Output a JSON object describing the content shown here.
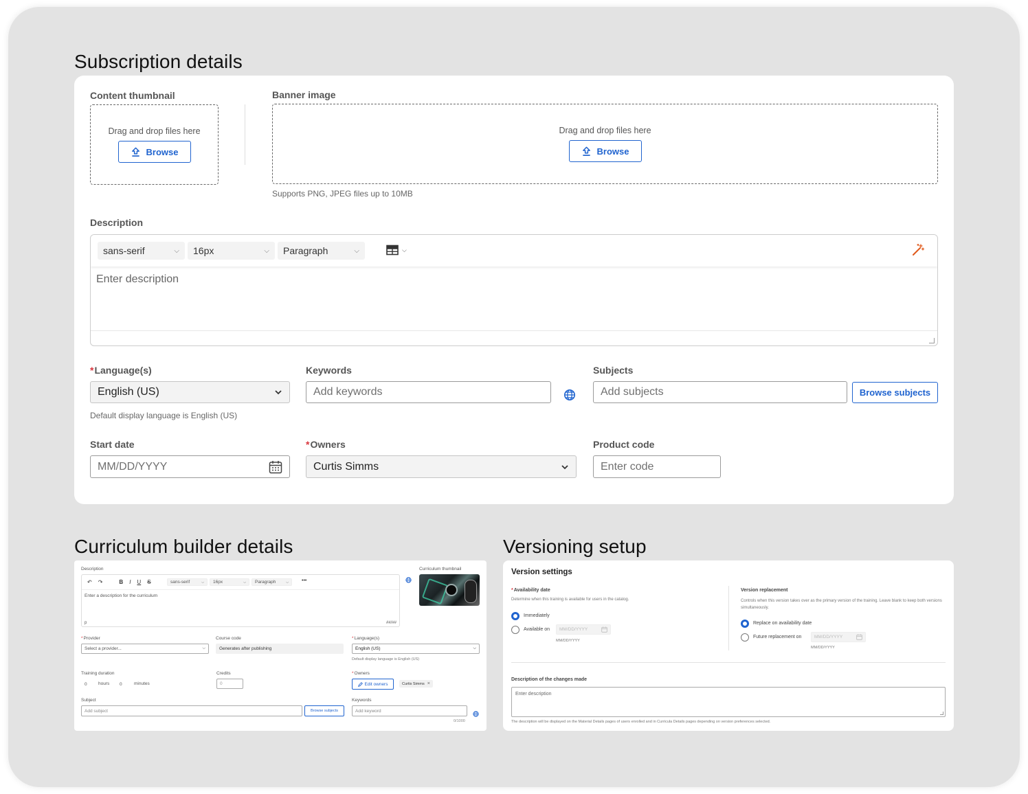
{
  "colors": {
    "accent": "#1f63cf",
    "required": "#d9363e",
    "background": "#e3e3e3"
  },
  "subscription": {
    "title": "Subscription details",
    "thumbnail": {
      "label": "Content thumbnail",
      "drop_text": "Drag and drop files here",
      "browse": "Browse"
    },
    "banner": {
      "label": "Banner image",
      "drop_text": "Drag and drop files here",
      "browse": "Browse",
      "hint": "Supports PNG, JPEG files up to 10MB"
    },
    "description": {
      "label": "Description",
      "font": "sans-serif",
      "size": "16px",
      "block": "Paragraph",
      "placeholder": "Enter description"
    },
    "language": {
      "required": "*",
      "label": "Language(s)",
      "value": "English (US)",
      "hint": "Default display language is English (US)"
    },
    "keywords": {
      "label": "Keywords",
      "placeholder": "Add keywords"
    },
    "subjects": {
      "label": "Subjects",
      "placeholder": "Add subjects",
      "browse": "Browse subjects"
    },
    "start_date": {
      "label": "Start date",
      "placeholder": "MM/DD/YYYY"
    },
    "owners": {
      "required": "*",
      "label": "Owners",
      "value": "Curtis Simms"
    },
    "product_code": {
      "label": "Product code",
      "placeholder": "Enter code"
    }
  },
  "curriculum": {
    "title": "Curriculum builder details",
    "description": {
      "label": "Description",
      "font": "sans-serif",
      "size": "16px",
      "block": "Paragraph",
      "more": "•••",
      "placeholder": "Enter a description for the curriculum",
      "footer_left": "p",
      "footer_right": "##/##"
    },
    "thumbnail_label": "Curriculum thumbnail",
    "provider": {
      "required": "*",
      "label": "Provider",
      "value": "Select a provider..."
    },
    "course_code": {
      "label": "Course code",
      "value": "Generates after publishing"
    },
    "language": {
      "required": "*",
      "label": "Language(s)",
      "value": "English (US)",
      "hint": "Default display language is English (US)"
    },
    "duration": {
      "label": "Training duration",
      "hours_value": "0",
      "hours_unit": "hours",
      "minutes_value": "0",
      "minutes_unit": "minutes"
    },
    "credits": {
      "label": "Credits",
      "value": "0"
    },
    "owners": {
      "required": "*",
      "label": "Owners",
      "edit": "Edit owners",
      "chip": "Curtis Simms"
    },
    "subject": {
      "label": "Subject",
      "placeholder": "Add subject",
      "browse": "Browse subjects"
    },
    "keywords": {
      "label": "Keywords",
      "placeholder": "Add keyword",
      "counter": "0/1000"
    }
  },
  "versioning": {
    "title": "Versioning setup",
    "card_title": "Version settings",
    "availability": {
      "required": "*",
      "label": "Availability date",
      "hint": "Determine when this training is available for users in the catalog.",
      "opt1": "Immediately",
      "opt2": "Available on",
      "date_placeholder": "MM/DD/YYYY",
      "date_hint": "MM/DD/YYYY"
    },
    "replacement": {
      "label": "Version replacement",
      "hint": "Controls when this version takes over as the primary version of the training. Leave blank to keep both versions simultaneously.",
      "opt1": "Replace on availability date",
      "opt2": "Future replacement on",
      "date_placeholder": "MM/DD/YYYY",
      "date_hint": "MM/DD/YYYY"
    },
    "changes": {
      "label": "Description of the changes made",
      "placeholder": "Enter description",
      "hint": "The description will be displayed on the Material Details pages of users enrolled and in Curricula Details pages depending on version preferences selected."
    }
  }
}
